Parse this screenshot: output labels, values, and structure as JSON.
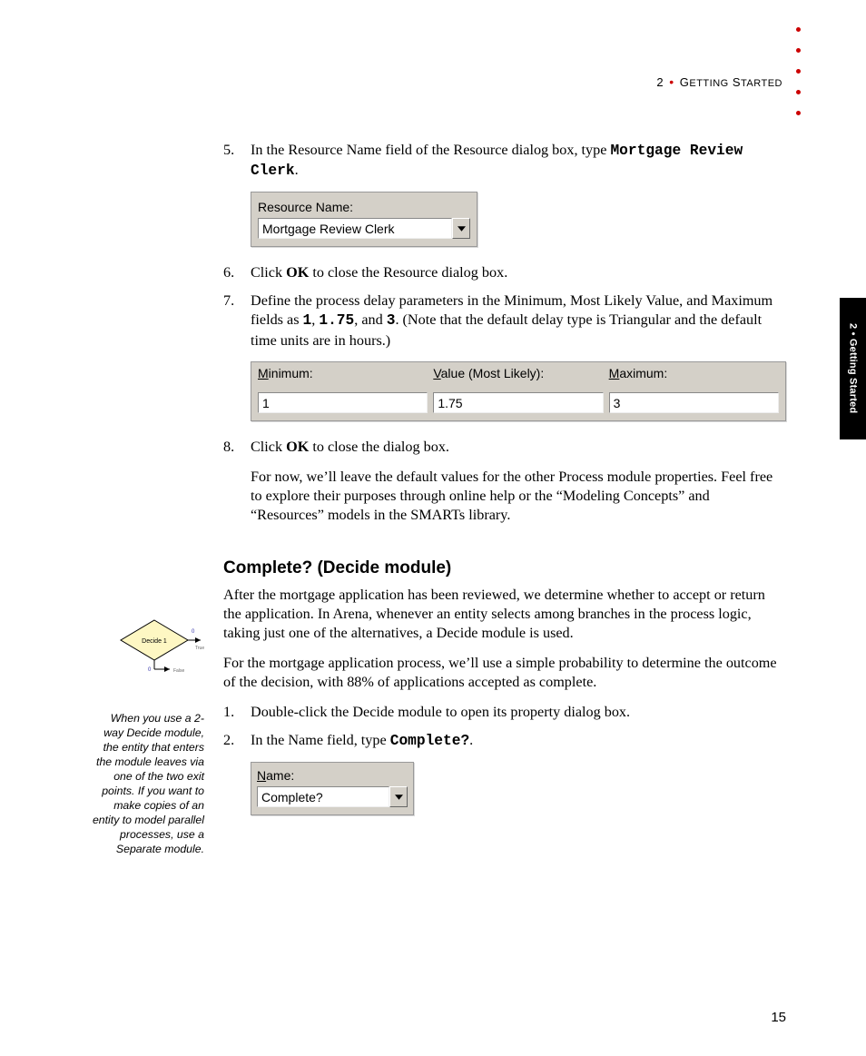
{
  "header": {
    "chapter_num": "2",
    "chapter_title_prefix": "G",
    "chapter_title_rest": "ETTING",
    "chapter_title_prefix2": "S",
    "chapter_title_rest2": "TARTED"
  },
  "side_tab": "2 • Getting Started",
  "steps": {
    "s5_num": "5.",
    "s5_text_a": "In the Resource Name field of the Resource dialog box, type ",
    "s5_code": "Mortgage Review Clerk",
    "s5_text_b": ".",
    "s6_num": "6.",
    "s6_a": "Click ",
    "s6_bold": "OK",
    "s6_b": " to close the Resource dialog box.",
    "s7_num": "7.",
    "s7_a": "Define the process delay parameters in the Minimum, Most Likely Value, and Maximum fields as ",
    "s7_c1": "1",
    "s7_mid1": ", ",
    "s7_c2": "1.75",
    "s7_mid2": ", and ",
    "s7_c3": "3",
    "s7_b": ". (Note that the default delay type is Triangular and the default time units are in hours.)",
    "s8_num": "8.",
    "s8_a": "Click ",
    "s8_bold": "OK",
    "s8_b": " to close the dialog box.",
    "s8_para": "For now, we’ll leave the default values for the other Process module properties. Feel free to explore their purposes through online help or the “Modeling Concepts” and “Resources” models in the SMARTs library."
  },
  "resource_ui": {
    "label": "Resource Name:",
    "value": "Mortgage Review Clerk"
  },
  "delay_ui": {
    "min_u": "M",
    "min_rest": "inimum:",
    "val_u": "V",
    "val_rest": "alue (Most Likely):",
    "max_u": "M",
    "max_rest": "aximum:",
    "min_value": "1",
    "val_value": "1.75",
    "max_value": "3"
  },
  "section": {
    "heading": "Complete? (Decide module)",
    "p1": "After the mortgage application has been reviewed, we determine whether to accept or return the application. In Arena, whenever an entity selects among branches in the process logic, taking just one of the alternatives, a Decide module is used.",
    "p2": "For the mortgage application process, we’ll use a simple probability to determine the outcome of the decision, with 88% of applications accepted as complete.",
    "d1_num": "1.",
    "d1_text": "Double-click the Decide module to open its property dialog box.",
    "d2_num": "2.",
    "d2_a": "In the Name field, type ",
    "d2_code": "Complete?",
    "d2_b": "."
  },
  "name_ui": {
    "label_u": "N",
    "label_rest": "ame:",
    "value": "Complete?"
  },
  "sidebar_note": "When you use a 2-way Decide module, the entity that enters the module leaves via one of the two exit points. If you want to make copies of an entity to model parallel processes, use a Separate module.",
  "decide_icon_label": "Decide 1",
  "page_number": "15"
}
